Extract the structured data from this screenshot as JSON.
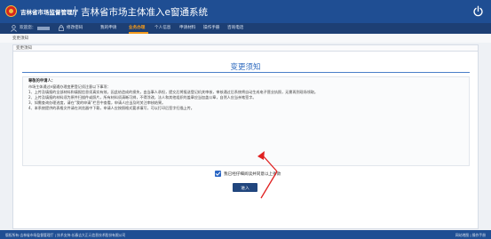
{
  "header": {
    "agency": "吉林省市场监督管理厅",
    "system_title": "吉林省市场主体准入e窗通系统"
  },
  "nav": {
    "greeting": "欢迎您：",
    "change_password": "修改密码",
    "items": [
      "我的申请",
      "业务办理",
      "个人信息",
      "申请材料",
      "操作手册",
      "咨询电话"
    ],
    "active_index": 1
  },
  "breadcrumb": "变更须知",
  "panel": {
    "head_label": "变更须知",
    "title": "变更须知",
    "notice": {
      "greeting": "尊敬的申请人：",
      "intro": "市场主体通过e窗通办理变更登记须注意以下事项：",
      "rules": [
        "1、上传及填报的全部材料和填报信息须真实有效，因此给造成的损失，由当事人承担，提交后将报送登记机关审核，审核通过后系统将自动生成电子营业执照，无需再到现场领取。",
        "2、上传及填报的材料须为原件扫描件或照片，所有材料须清晰可辨，不得涂改，法人和其他组织的盖章应当加盖公章，自然人应当亲笔签字。",
        "3、如需查询办理进度，请在“我的申请”栏目中查看，申请人应当及时关注审核结果。",
        "4、本系统提供的表格文件请在浏览器中下载，申请人应按照格式要求填写，可以打印后签字扫描上传。"
      ]
    },
    "agree_label": "我已经仔细阅读并同意以上条款",
    "agree_checked": true,
    "enter_button": "进入"
  },
  "footer": {
    "copyright": "版权所有:吉林省市场监督管理厅 | 技术支持:长春吉大正元信息技术股份有限公司",
    "right_links": "网站地图 | 操作手册"
  }
}
